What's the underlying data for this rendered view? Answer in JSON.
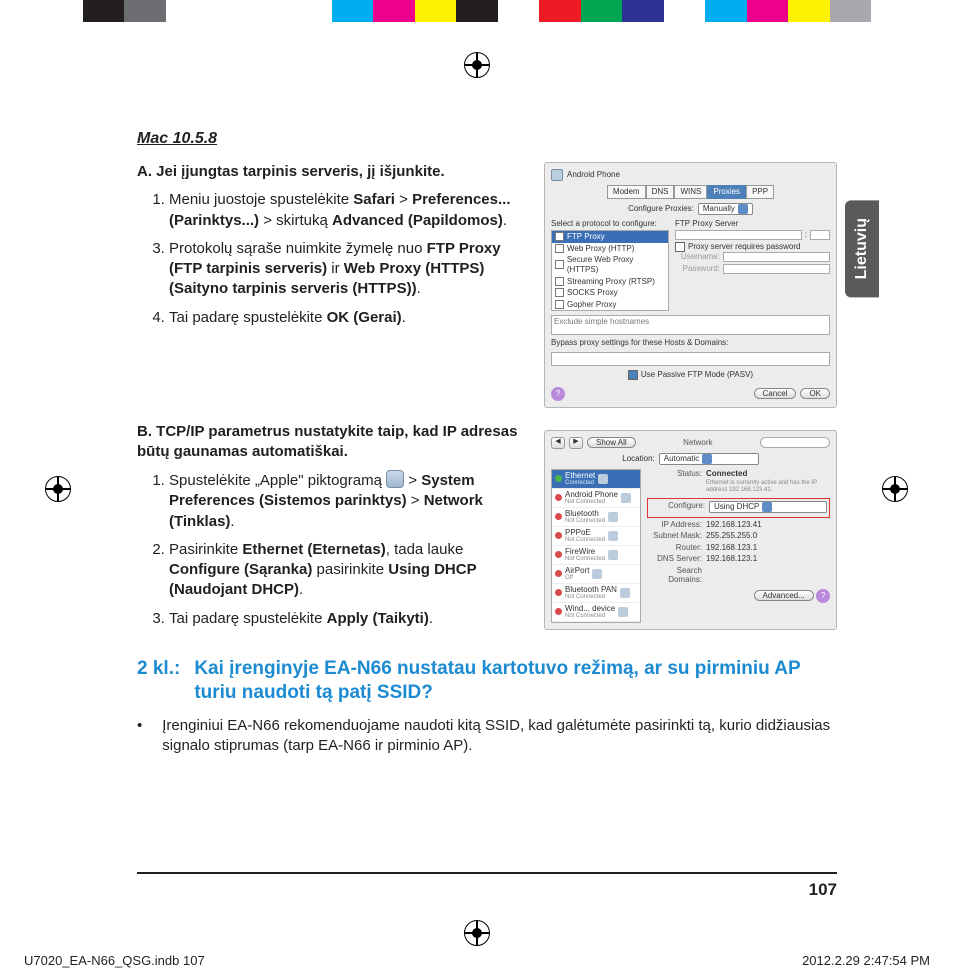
{
  "meta": {
    "language_tab": "Lietuvių",
    "page_number": "107",
    "footer_left": "U7020_EA-N66_QSG.indb   107",
    "footer_right": "2012.2.29   2:47:54 PM"
  },
  "section_title": "Mac 10.5.8",
  "section_a": {
    "heading": "A. Jei įjungtas tarpinis serveris, jį išjunkite.",
    "steps": [
      {
        "pre": "Meniu juostoje spustelėkite ",
        "b1": "Safari",
        "mid1": " > ",
        "b2": "Preferences... (Parinktys...)",
        "mid2": " > skirtuką ",
        "b3": "Advanced (Papildomos)",
        "post": "."
      },
      {
        "full_skip": true
      },
      {
        "pre": "Protokolų sąraše nuimkite žymelę nuo ",
        "b1": "FTP Proxy (FTP tarpinis serveris)",
        "mid1": " ir ",
        "b2": "Web Proxy (HTTPS) (Saityno tarpinis serveris (HTTPS))",
        "post": "."
      },
      {
        "pre": "Tai padarę spustelėkite ",
        "b1": "OK (Gerai)",
        "post": "."
      }
    ]
  },
  "section_b": {
    "heading": "B. TCP/IP parametrus nustatykite taip, kad IP adresas būtų gaunamas automatiškai.",
    "steps": [
      {
        "pre": "Spustelėkite „Apple\" piktogramą ",
        "icon": true,
        "mid1": " > ",
        "b1": "System Preferences (Sistemos parinktys)",
        "mid2": " > ",
        "b2": "Network (Tinklas)",
        "post": "."
      },
      {
        "pre": "Pasirinkite ",
        "b1": "Ethernet (Eternetas)",
        "mid1": ", tada lauke ",
        "b2": "Configure (Sąranka)",
        "mid2": " pasirinkite ",
        "b3": "Using DHCP (Naudojant DHCP)",
        "post": "."
      },
      {
        "pre": "Tai padarę spustelėkite ",
        "b1": "Apply (Taikyti)",
        "post": "."
      }
    ]
  },
  "q2": {
    "label": "2 kl.:",
    "text": "Kai įrenginyje EA-N66 nustatau kartotuvo režimą, ar su pirminiu AP turiu naudoti tą patį SSID?"
  },
  "answer": "Įrenginiui EA-N66 rekomenduojame naudoti kitą SSID, kad galėtumėte pasir­inkti tą, kurio didžiausias signalo stiprumas (tarp EA-N66 ir pirminio AP).",
  "shot1": {
    "device": "Android Phone",
    "tabs": [
      "Modem",
      "DNS",
      "WINS",
      "Proxies",
      "PPP"
    ],
    "active_tab": "Proxies",
    "cfg_label": "Configure Proxies:",
    "cfg_value": "Manually",
    "list_label": "Select a protocol to configure:",
    "server_label": "FTP Proxy Server",
    "protocols": [
      "FTP Proxy",
      "Web Proxy (HTTP)",
      "Secure Web Proxy (HTTPS)",
      "Streaming Proxy (RTSP)",
      "SOCKS Proxy",
      "Gopher Proxy"
    ],
    "req_pw": "Proxy server requires password",
    "user_label": "Username:",
    "pass_label": "Password:",
    "exclude": "Exclude simple hostnames",
    "bypass": "Bypass proxy settings for these Hosts & Domains:",
    "pasv": "Use Passive FTP Mode (PASV)",
    "cancel": "Cancel",
    "ok": "OK"
  },
  "shot2": {
    "title": "Network",
    "showall": "Show All",
    "loc_label": "Location:",
    "loc_value": "Automatic",
    "services": [
      {
        "name": "Ethernet",
        "sub": "Connected",
        "dot": "g",
        "sel": true
      },
      {
        "name": "Android Phone",
        "sub": "Not Connected",
        "dot": "r"
      },
      {
        "name": "Bluetooth",
        "sub": "Not Connected",
        "dot": "r"
      },
      {
        "name": "PPPoE",
        "sub": "Not Connected",
        "dot": "r"
      },
      {
        "name": "FireWire",
        "sub": "Not Connected",
        "dot": "r"
      },
      {
        "name": "AirPort",
        "sub": "Off",
        "dot": "r"
      },
      {
        "name": "Bluetooth PAN",
        "sub": "Not Connected",
        "dot": "r"
      },
      {
        "name": "Wind... device",
        "sub": "Not Connected",
        "dot": "r"
      }
    ],
    "status_label": "Status:",
    "status_value": "Connected",
    "status_sub": "Ethernet is currently active and has the IP address 192.168.123.41.",
    "cfg_label": "Configure:",
    "cfg_value": "Using DHCP",
    "rows": [
      {
        "k": "IP Address:",
        "v": "192.168.123.41"
      },
      {
        "k": "Subnet Mask:",
        "v": "255.255.255.0"
      },
      {
        "k": "Router:",
        "v": "192.168.123.1"
      },
      {
        "k": "DNS Server:",
        "v": "192.168.123.1"
      },
      {
        "k": "Search Domains:",
        "v": ""
      }
    ],
    "advanced": "Advanced..."
  },
  "colorbar": [
    "#fff",
    "#fff",
    "#231f20",
    "#6d6e71",
    "#fff",
    "#fff",
    "#fff",
    "#fff",
    "#00aeef",
    "#ec008c",
    "#fff200",
    "#231f20",
    "#fff",
    "#ed1c24",
    "#00a651",
    "#2e3192",
    "#fff",
    "#00aeef",
    "#ec008c",
    "#fff200",
    "#a7a9ac",
    "#fff",
    "#fff"
  ]
}
